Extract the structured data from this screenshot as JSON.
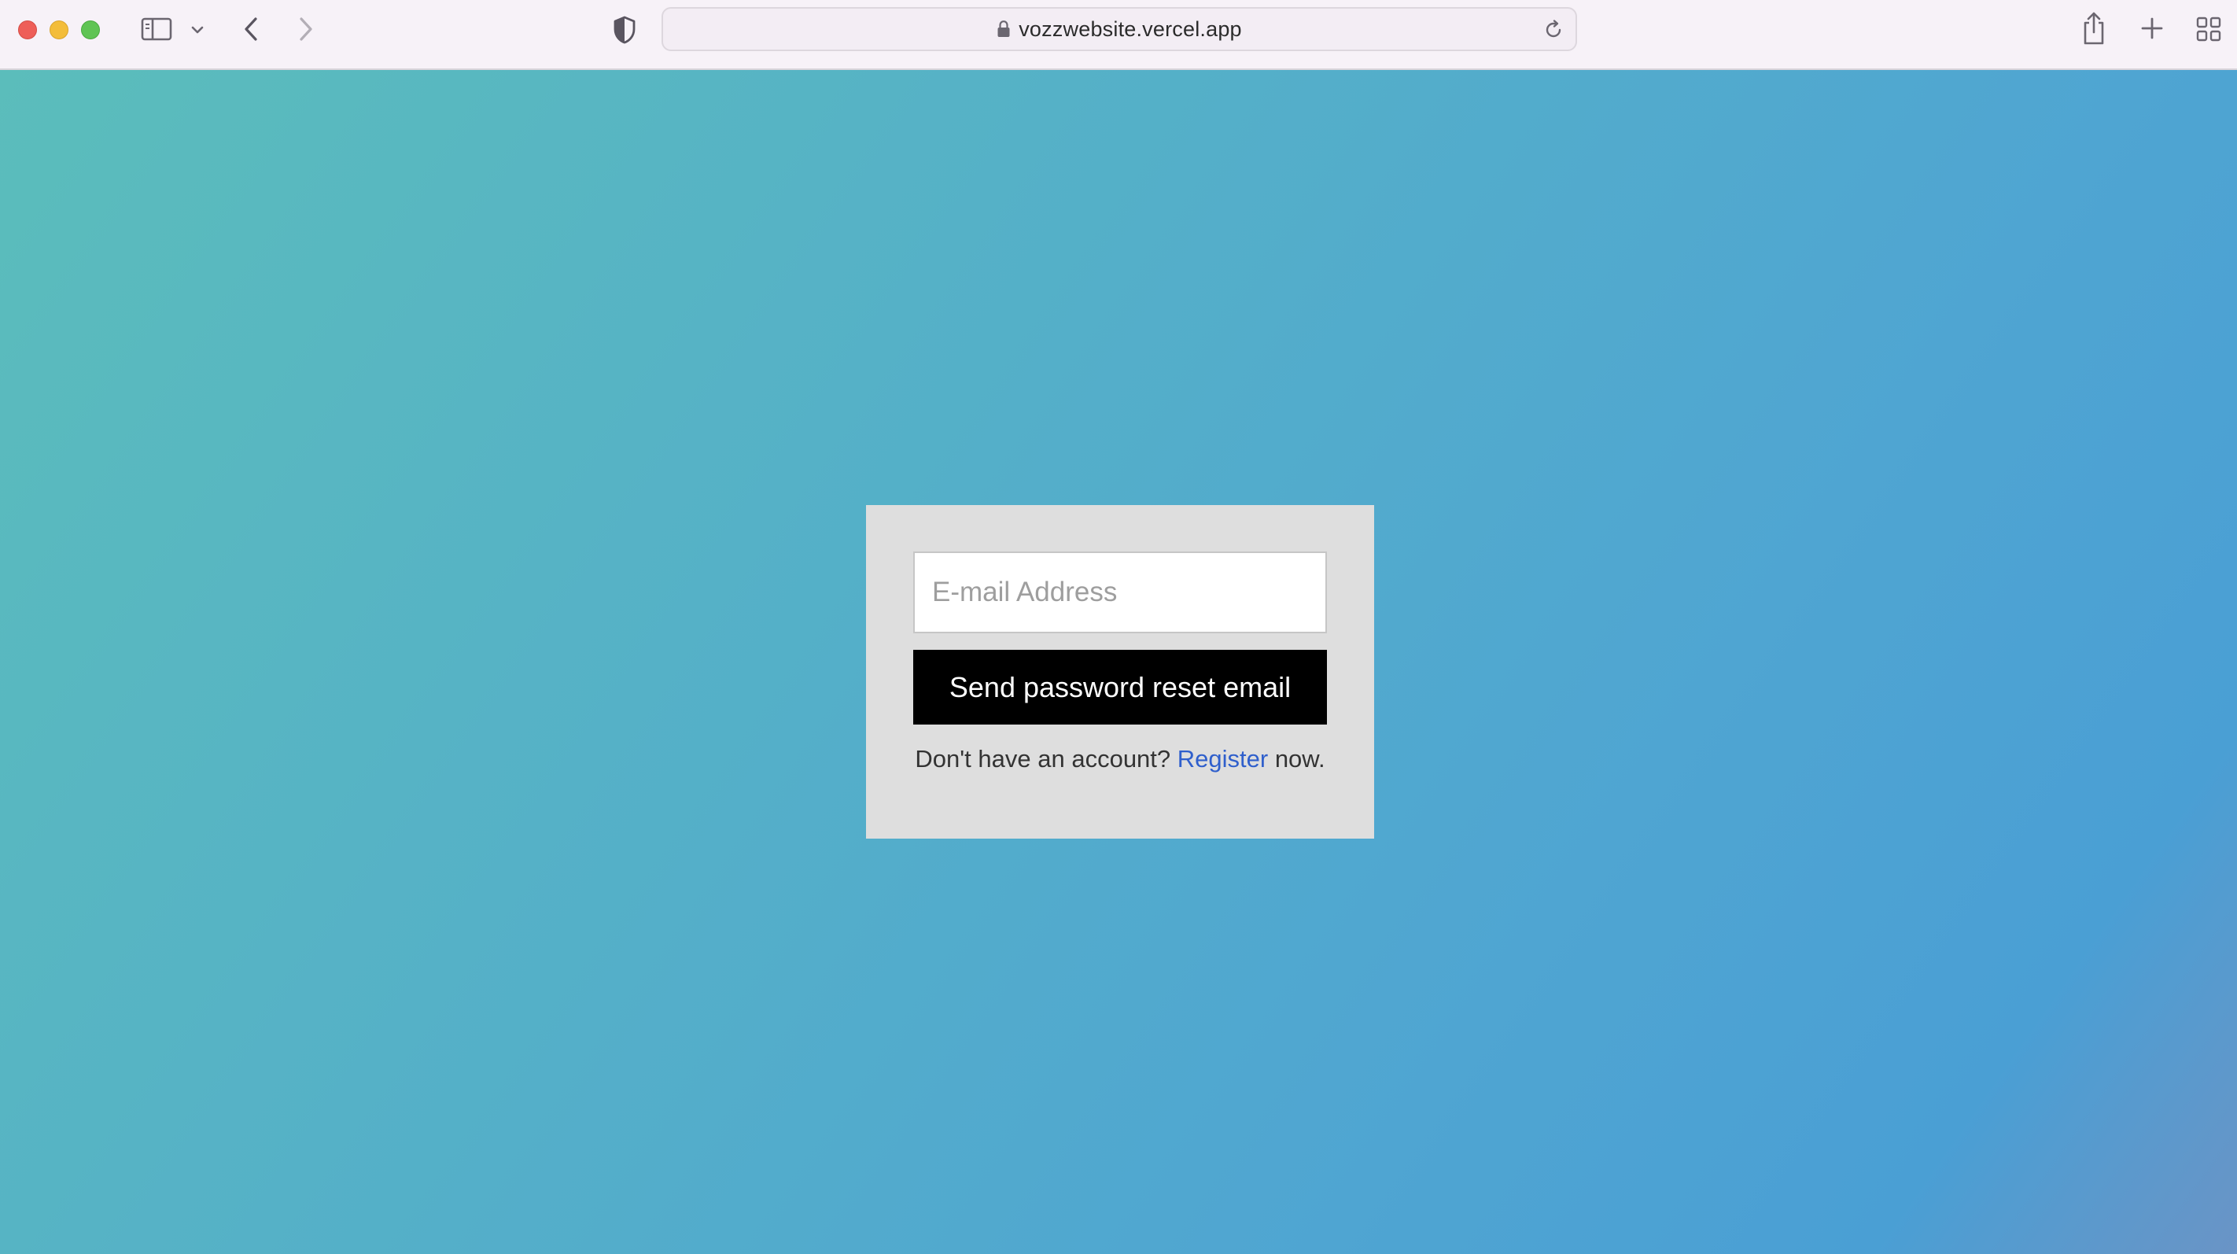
{
  "browser": {
    "url": "vozzwebsite.vercel.app",
    "icons": {
      "sidebar": "sidebar-icon",
      "sidebar_menu": "chevron-down-icon",
      "back": "chevron-left-icon",
      "forward": "chevron-right-icon",
      "privacy": "shield-icon",
      "lock": "lock-icon",
      "reload": "reload-icon",
      "share": "share-icon",
      "new_tab": "plus-icon",
      "tab_overview": "grid-icon"
    },
    "traffic_lights": {
      "close": "#ee5e58",
      "minimize": "#f3bd3a",
      "zoom": "#5fc454"
    }
  },
  "reset_form": {
    "email_placeholder": "E-mail Address",
    "email_value": "",
    "submit_label": "Send password reset email",
    "register_prefix": "Don't have an account? ",
    "register_link": "Register",
    "register_suffix": " now."
  },
  "colors": {
    "background_gradient_start": "#5bbdbb",
    "background_gradient_end": "#4a9fd4",
    "card_background": "#dedede",
    "button_background": "#000000",
    "link": "#2f5fcc"
  }
}
